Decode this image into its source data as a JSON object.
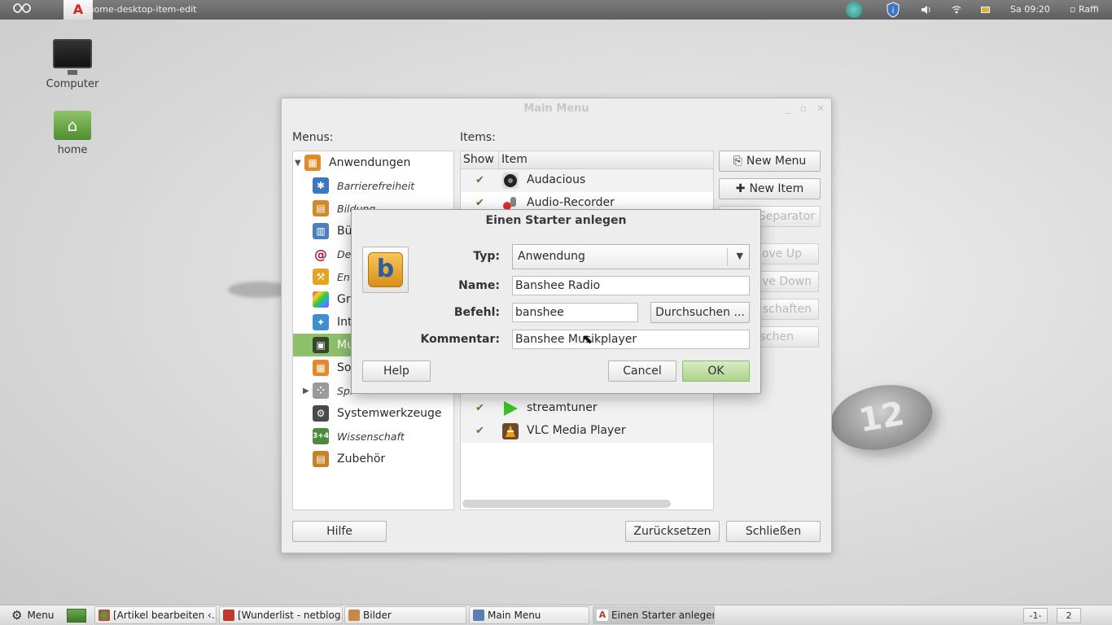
{
  "top_panel": {
    "active_app": "Gnome-desktop-item-edit",
    "clock": "Sa 09:20",
    "user": "Raffi",
    "tray_icons": [
      "update-manager-icon",
      "shield-info-icon",
      "volume-icon",
      "network-icon",
      "battery-icon"
    ]
  },
  "desktop": {
    "icons": [
      {
        "label": "Computer",
        "icon": "computer-icon"
      },
      {
        "label": "home",
        "icon": "home-folder-icon"
      }
    ],
    "badge": "12"
  },
  "main_window": {
    "title": "Main Menu",
    "menus_label": "Menus:",
    "items_label": "Items:",
    "menu_tree": [
      {
        "label": "Anwendungen",
        "icon": "applications-icon",
        "color": "#e08a2c"
      },
      {
        "label": "Barrierefreiheit",
        "icon": "accessibility-icon",
        "color": "#3a78c2"
      },
      {
        "label": "Bildung",
        "icon": "education-icon",
        "color": "#d2892e"
      },
      {
        "label": "Bü",
        "icon": "office-icon",
        "color": "#4d7fbf"
      },
      {
        "label": "De",
        "icon": "debian-icon",
        "color": "#c0143c"
      },
      {
        "label": "En",
        "icon": "development-icon",
        "color": "#e6a320"
      },
      {
        "label": "Gr",
        "icon": "graphics-icon",
        "color": "#b84ea3"
      },
      {
        "label": "Int",
        "icon": "internet-icon",
        "color": "#3f8fd0"
      },
      {
        "label": "Mu",
        "icon": "multimedia-icon",
        "color": "#4e6b3a"
      },
      {
        "label": "So",
        "icon": "other-icon",
        "color": "#e08a2c"
      },
      {
        "label": "Spi",
        "icon": "games-icon",
        "color": "#8a8a8a"
      },
      {
        "label": "Systemwerkzeuge",
        "icon": "system-tools-icon",
        "color": "#555555"
      },
      {
        "label": "Wissenschaft",
        "icon": "science-icon",
        "color": "#4f8a3c"
      },
      {
        "label": "Zubehör",
        "icon": "accessories-icon",
        "color": "#c6812a"
      }
    ],
    "items_columns": [
      "Show",
      "Item"
    ],
    "items": [
      {
        "label": "Audacious",
        "shown": true
      },
      {
        "label": "Audio-Recorder",
        "shown": true
      },
      {
        "label": "streamtuner",
        "shown": true
      },
      {
        "label": "VLC Media Player",
        "shown": true
      }
    ],
    "side_buttons": {
      "new_menu": "New Menu",
      "new_item": "New Item",
      "new_separator": "Separator",
      "move_up": "ove Up",
      "move_down": "ve Down",
      "properties": "schaften",
      "delete": "schen"
    },
    "bottom_buttons": {
      "help": "Hilfe",
      "revert": "Zurücksetzen",
      "close": "Schließen"
    }
  },
  "dialog": {
    "title": "Einen Starter anlegen",
    "type_label": "Typ:",
    "type_value": "Anwendung",
    "name_label": "Name:",
    "name_value": "Banshee Radio",
    "command_label": "Befehl:",
    "command_value": "banshee",
    "browse_label": "Durchsuchen ...",
    "comment_label": "Kommentar:",
    "comment_value": "Banshee Musikplayer",
    "help": "Help",
    "cancel": "Cancel",
    "ok": "OK"
  },
  "taskbar": {
    "menu_label": "Menu",
    "tasks": [
      {
        "label": "[Artikel bearbeiten ‹...",
        "color": "#d9534f"
      },
      {
        "label": "[Wunderlist - netblog...",
        "color": "#c0392b"
      },
      {
        "label": "Bilder",
        "color": "#c9874a"
      },
      {
        "label": "Main Menu",
        "color": "#5a7fb5"
      },
      {
        "label": "Einen Starter anlegen",
        "color": "#c0392b"
      }
    ],
    "workspaces": [
      "-1-",
      "2"
    ]
  }
}
